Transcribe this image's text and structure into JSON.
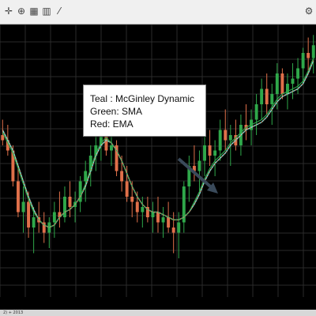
{
  "toolbar": {
    "icons": [
      "crosshair-icon",
      "zoom-icon",
      "grid-icon",
      "bars-icon",
      "line-icon",
      "settings-icon"
    ],
    "bottom_text": "2) + 2013"
  },
  "annotation": {
    "lines": [
      "Teal : McGinley Dynamic",
      "Green: SMA",
      "Red: EMA"
    ]
  },
  "colors": {
    "background": "#000000",
    "grid": "#2a2a2a",
    "up_candle": "#2fa84a",
    "down_candle": "#e0704a",
    "mcginley": "#79e3dc",
    "sma": "#2ea84a",
    "ema": "#e0704a",
    "arrow": "#3a4a5a"
  },
  "chart_data": {
    "type": "candlestick",
    "title": "",
    "xlabel": "",
    "ylabel": "",
    "grid": true,
    "ylim": [
      0,
      100
    ],
    "series": [
      {
        "name": "McGinley Dynamic",
        "values": [
          62,
          58,
          54,
          48,
          42,
          36,
          31,
          27,
          25,
          24,
          25,
          28,
          30,
          31,
          33,
          36,
          40,
          46,
          52,
          56,
          58,
          57,
          54,
          50,
          45,
          40,
          36,
          33,
          31,
          30,
          30,
          29,
          28,
          27,
          27,
          28,
          30,
          33,
          37,
          42,
          46,
          49,
          51,
          53,
          56,
          58,
          60,
          62,
          63,
          64,
          65,
          67,
          70,
          73,
          75,
          76,
          77,
          78,
          80,
          84,
          89
        ]
      },
      {
        "name": "SMA",
        "values": [
          61,
          57,
          53,
          47,
          41,
          35,
          30,
          27,
          25,
          24,
          25,
          28,
          30,
          31,
          33,
          36,
          41,
          47,
          53,
          57,
          59,
          57,
          54,
          50,
          45,
          40,
          36,
          33,
          31,
          30,
          30,
          29,
          28,
          27,
          27,
          28,
          30,
          34,
          38,
          43,
          47,
          50,
          52,
          54,
          57,
          59,
          61,
          63,
          64,
          65,
          66,
          68,
          71,
          74,
          76,
          77,
          78,
          79,
          81,
          85,
          90
        ]
      },
      {
        "name": "EMA",
        "values": [
          62,
          58,
          54,
          48,
          42,
          36,
          31,
          27,
          25,
          24,
          25,
          28,
          30,
          31,
          33,
          36,
          40,
          46,
          52,
          56,
          58,
          57,
          54,
          50,
          45,
          40,
          36,
          33,
          31,
          30,
          30,
          29,
          28,
          27,
          27,
          28,
          30,
          33,
          37,
          42,
          46,
          49,
          51,
          53,
          56,
          58,
          60,
          62,
          63,
          64,
          65,
          67,
          70,
          73,
          75,
          76,
          77,
          78,
          80,
          84,
          89
        ]
      }
    ],
    "candles": [
      [
        60,
        66,
        56,
        58
      ],
      [
        58,
        64,
        52,
        54
      ],
      [
        54,
        56,
        40,
        42
      ],
      [
        42,
        48,
        28,
        30
      ],
      [
        30,
        40,
        22,
        34
      ],
      [
        34,
        38,
        20,
        24
      ],
      [
        24,
        32,
        14,
        28
      ],
      [
        28,
        34,
        22,
        26
      ],
      [
        26,
        30,
        18,
        22
      ],
      [
        22,
        28,
        16,
        26
      ],
      [
        26,
        34,
        20,
        30
      ],
      [
        30,
        38,
        24,
        28
      ],
      [
        28,
        40,
        26,
        36
      ],
      [
        36,
        42,
        28,
        32
      ],
      [
        32,
        38,
        26,
        34
      ],
      [
        34,
        44,
        30,
        42
      ],
      [
        42,
        50,
        34,
        46
      ],
      [
        46,
        56,
        40,
        52
      ],
      [
        52,
        60,
        46,
        56
      ],
      [
        56,
        62,
        50,
        60
      ],
      [
        60,
        64,
        52,
        54
      ],
      [
        54,
        60,
        48,
        56
      ],
      [
        56,
        58,
        44,
        46
      ],
      [
        46,
        52,
        38,
        42
      ],
      [
        42,
        48,
        34,
        36
      ],
      [
        36,
        42,
        28,
        34
      ],
      [
        34,
        38,
        26,
        30
      ],
      [
        30,
        36,
        24,
        32
      ],
      [
        32,
        36,
        26,
        28
      ],
      [
        28,
        34,
        22,
        30
      ],
      [
        30,
        36,
        22,
        26
      ],
      [
        26,
        32,
        20,
        28
      ],
      [
        28,
        34,
        22,
        24
      ],
      [
        24,
        30,
        14,
        22
      ],
      [
        22,
        30,
        12,
        26
      ],
      [
        26,
        42,
        22,
        40
      ],
      [
        40,
        52,
        34,
        48
      ],
      [
        48,
        56,
        42,
        46
      ],
      [
        46,
        54,
        38,
        50
      ],
      [
        50,
        60,
        44,
        56
      ],
      [
        56,
        62,
        48,
        52
      ],
      [
        52,
        58,
        44,
        54
      ],
      [
        54,
        66,
        50,
        62
      ],
      [
        62,
        70,
        54,
        58
      ],
      [
        58,
        64,
        48,
        60
      ],
      [
        60,
        66,
        54,
        56
      ],
      [
        56,
        68,
        52,
        64
      ],
      [
        64,
        72,
        58,
        62
      ],
      [
        62,
        70,
        56,
        66
      ],
      [
        66,
        76,
        60,
        72
      ],
      [
        72,
        82,
        66,
        78
      ],
      [
        78,
        84,
        68,
        72
      ],
      [
        72,
        80,
        64,
        76
      ],
      [
        76,
        88,
        70,
        84
      ],
      [
        84,
        86,
        74,
        76
      ],
      [
        76,
        84,
        70,
        80
      ],
      [
        80,
        88,
        74,
        82
      ],
      [
        82,
        90,
        76,
        86
      ],
      [
        86,
        94,
        80,
        92
      ],
      [
        92,
        98,
        84,
        90
      ],
      [
        90,
        99,
        84,
        95
      ]
    ]
  }
}
